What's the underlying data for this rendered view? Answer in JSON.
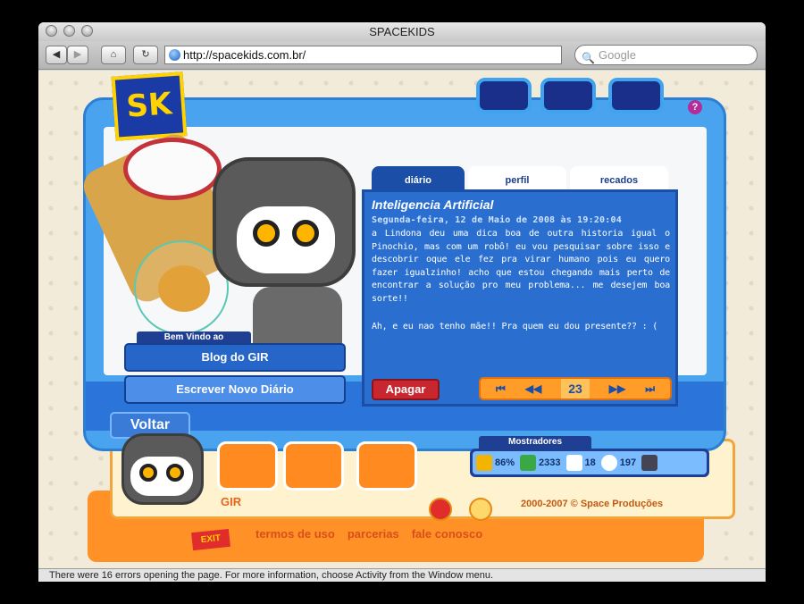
{
  "window": {
    "title": "SPACEKIDS"
  },
  "toolbar": {
    "back_icon": "back-arrow-icon",
    "forward_icon": "forward-arrow-icon",
    "home_icon": "home-icon",
    "reload_icon": "reload-icon",
    "url": "http://spacekids.com.br/",
    "search_placeholder": "Google"
  },
  "site": {
    "logo_text": "SK",
    "help_label": "?",
    "welcome_label": "Bem Vindo ao",
    "blog_button": "Blog do GIR",
    "new_diary_button": "Escrever Novo Diário",
    "back_button": "Voltar",
    "tabs": [
      {
        "label": "diário",
        "active": true
      },
      {
        "label": "perfil",
        "active": false
      },
      {
        "label": "recados",
        "active": false
      }
    ],
    "diary": {
      "title": "Inteligencia Artificial",
      "date": "Segunda-feira, 12 de Maio de 2008 às 19:20:04",
      "paragraphs": [
        "a Lindona deu uma dica boa de outra historia igual o Pinochio, mas com um robô! eu vou pesquisar sobre isso e descobrir oque ele fez pra virar humano pois eu quero fazer igualzinho! acho que estou chegando mais perto de encontrar a solução pro meu problema... me desejem boa sorte!!",
        "Ah, e eu nao tenho mãe!! Pra quem eu dou presente?? : ("
      ],
      "delete_button": "Apagar",
      "pager": {
        "first": "⏮",
        "prev": "◀◀",
        "page": "23",
        "next": "▶▶",
        "last": "⏭"
      }
    },
    "character_name": "GIR",
    "copyright": "2000-2007 © Space Produções",
    "mostradores": {
      "label": "Mostradores",
      "energy": "86%",
      "money": "2333",
      "mail": "18",
      "chat": "197"
    },
    "footer_links": [
      "termos de uso",
      "parcerias",
      "fale conosco"
    ],
    "exit_label": "EXIT"
  },
  "status": {
    "text": "There were 16 errors opening the page. For more information, choose Activity from the Window menu."
  },
  "colors": {
    "accent": "#2a6fd0",
    "orange": "#ff9126",
    "background": "#f2ebd9"
  }
}
